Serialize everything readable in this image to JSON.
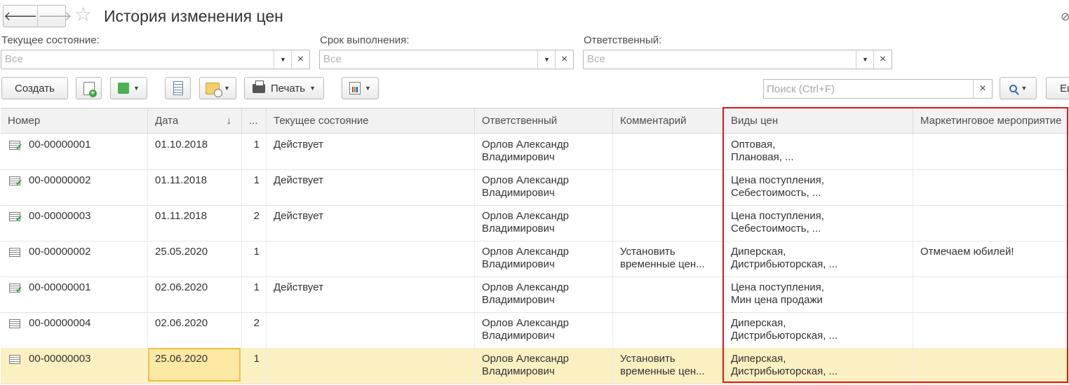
{
  "window": {
    "title": "История изменения цен"
  },
  "filters": [
    {
      "label": "Текущее состояние:",
      "value": "Все"
    },
    {
      "label": "Срок выполнения:",
      "value": "Все"
    },
    {
      "label": "Ответственный:",
      "value": "Все"
    }
  ],
  "toolbar": {
    "create_label": "Создать",
    "print_label": "Печать",
    "search_placeholder": "Поиск (Ctrl+F)",
    "more_label": "Ещ"
  },
  "table": {
    "columns": [
      "Номер",
      "Дата",
      "...",
      "Текущее состояние",
      "Ответственный",
      "Комментарий",
      "Виды цен",
      "Маркетинговое мероприятие"
    ],
    "rows": [
      {
        "num": "00-00000001",
        "date": "01.10.2018",
        "n": "1",
        "state": "Действует",
        "resp1": "Орлов Александр",
        "resp2": "Владимирович",
        "comm1": "",
        "comm2": "",
        "price1": "Оптовая,",
        "price2": "Плановая, ...",
        "mkt": ""
      },
      {
        "num": "00-00000002",
        "date": "01.11.2018",
        "n": "1",
        "state": "Действует",
        "resp1": "Орлов Александр",
        "resp2": "Владимирович",
        "comm1": "",
        "comm2": "",
        "price1": "Цена поступления,",
        "price2": "Себестоимость, ...",
        "mkt": ""
      },
      {
        "num": "00-00000003",
        "date": "01.11.2018",
        "n": "2",
        "state": "Действует",
        "resp1": "Орлов Александр",
        "resp2": "Владимирович",
        "comm1": "",
        "comm2": "",
        "price1": "Цена поступления,",
        "price2": "Себестоимость, ...",
        "mkt": ""
      },
      {
        "num": "00-00000002",
        "date": "25.05.2020",
        "n": "1",
        "state": "",
        "resp1": "Орлов Александр",
        "resp2": "Владимирович",
        "comm1": "Установить",
        "comm2": "временные цен...",
        "price1": "Диперская,",
        "price2": "Дистрибьюторская, ...",
        "mkt": "Отмечаем юбилей!"
      },
      {
        "num": "00-00000001",
        "date": "02.06.2020",
        "n": "1",
        "state": "Действует",
        "resp1": "Орлов Александр",
        "resp2": "Владимирович",
        "comm1": "",
        "comm2": "",
        "price1": "Цена поступления,",
        "price2": "Мин цена продажи",
        "mkt": ""
      },
      {
        "num": "00-00000004",
        "date": "02.06.2020",
        "n": "2",
        "state": "",
        "resp1": "Орлов Александр",
        "resp2": "Владимирович",
        "comm1": "",
        "comm2": "",
        "price1": "Диперская,",
        "price2": "Дистрибьюторская, ...",
        "mkt": ""
      },
      {
        "num": "00-00000003",
        "date": "25.06.2020",
        "n": "1",
        "state": "",
        "resp1": "Орлов Александр",
        "resp2": "Владимирович",
        "comm1": "Установить",
        "comm2": "временные цен...",
        "price1": "Диперская,",
        "price2": "Дистрибьюторская, ...",
        "mkt": ""
      }
    ]
  },
  "colors": {
    "selected_row": "#fbf0c2",
    "focus_border": "#f0c23a",
    "highlight_frame": "#e0151d",
    "check_green": "#2ea043"
  },
  "icons": [
    "back-arrow-icon",
    "forward-arrow-icon",
    "star-icon",
    "link-icon",
    "add-copy-icon",
    "green-transfer-icon",
    "list-icon",
    "folder-clock-icon",
    "printer-icon",
    "report-icon",
    "search-icon",
    "document-approved-icon",
    "document-icon"
  ]
}
